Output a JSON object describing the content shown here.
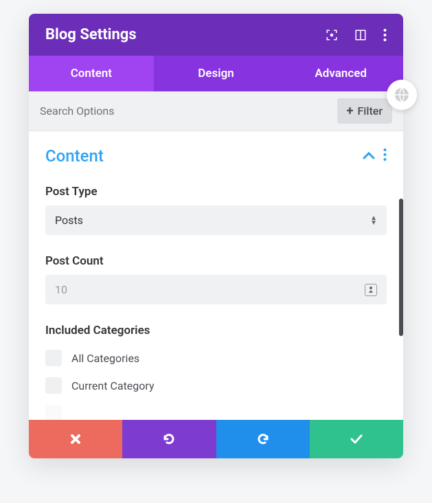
{
  "header": {
    "title": "Blog Settings"
  },
  "tabs": {
    "content": "Content",
    "design": "Design",
    "advanced": "Advanced"
  },
  "filters": {
    "placeholder": "Search Options",
    "filter_label": "Filter"
  },
  "section": {
    "title": "Content"
  },
  "fields": {
    "post_type": {
      "label": "Post Type",
      "value": "Posts"
    },
    "post_count": {
      "label": "Post Count",
      "value": "10"
    },
    "included_categories": {
      "label": "Included Categories",
      "options": {
        "all": "All Categories",
        "current": "Current Category"
      }
    }
  }
}
